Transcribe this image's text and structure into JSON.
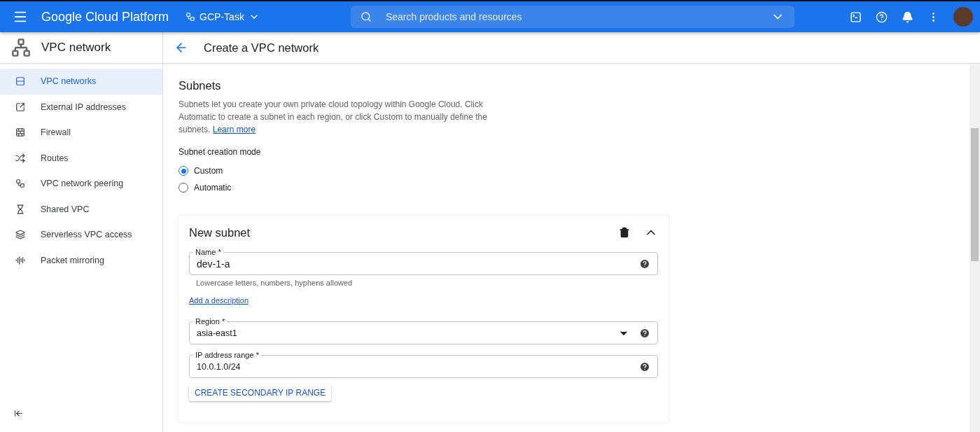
{
  "header": {
    "product": "Google Cloud Platform",
    "project": "GCP-Task",
    "search": {
      "placeholder": "Search products and resources"
    }
  },
  "sidebar": {
    "title": "VPC network",
    "items": [
      {
        "label": "VPC networks",
        "selected": true
      },
      {
        "label": "External IP addresses",
        "selected": false
      },
      {
        "label": "Firewall",
        "selected": false
      },
      {
        "label": "Routes",
        "selected": false
      },
      {
        "label": "VPC network peering",
        "selected": false
      },
      {
        "label": "Shared VPC",
        "selected": false
      },
      {
        "label": "Serverless VPC access",
        "selected": false
      },
      {
        "label": "Packet mirroring",
        "selected": false
      }
    ]
  },
  "page": {
    "title": "Create a VPC network"
  },
  "subnets": {
    "title": "Subnets",
    "description": "Subnets let you create your own private cloud topology within Google Cloud. Click Automatic to create a subnet in each region, or click Custom to manually define the subnets.",
    "learn_more": "Learn more",
    "mode_label": "Subnet creation mode",
    "modes": [
      {
        "label": "Custom",
        "selected": true
      },
      {
        "label": "Automatic",
        "selected": false
      }
    ]
  },
  "subnet_card": {
    "title": "New subnet",
    "name_field": {
      "label": "Name *",
      "value": "dev-1-a",
      "kind": "text",
      "hint": "Lowercase letters, numbers, hyphens allowed"
    },
    "add_description": "Add a description",
    "fields": [
      {
        "label": "Region *",
        "value": "asia-east1",
        "kind": "select"
      },
      {
        "label": "IP address range *",
        "value": "10.0.1.0/24",
        "kind": "text"
      }
    ],
    "button": "CREATE SECONDARY IP RANGE"
  }
}
